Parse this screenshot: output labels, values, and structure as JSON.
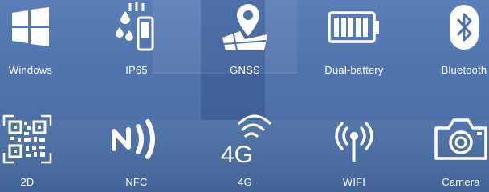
{
  "features": [
    {
      "label": "Windows",
      "icon": "windows-logo-icon"
    },
    {
      "label": "IP65",
      "icon": "water-resistant-device-icon"
    },
    {
      "label": "GNSS",
      "icon": "map-pin-icon"
    },
    {
      "label": "Dual-battery",
      "icon": "battery-icon"
    },
    {
      "label": "Bluetooth",
      "icon": "bluetooth-icon"
    },
    {
      "label": "2D",
      "icon": "qr-code-icon"
    },
    {
      "label": "NFC",
      "icon": "nfc-icon"
    },
    {
      "label": "4G",
      "icon": "4g-signal-icon"
    },
    {
      "label": "WIFI",
      "icon": "wifi-antenna-icon"
    },
    {
      "label": "Camera",
      "icon": "camera-icon"
    }
  ],
  "icon_glyphs": {
    "4g": "4G"
  },
  "colors": {
    "icon": "#ffffff",
    "background": "#4e73ab"
  }
}
